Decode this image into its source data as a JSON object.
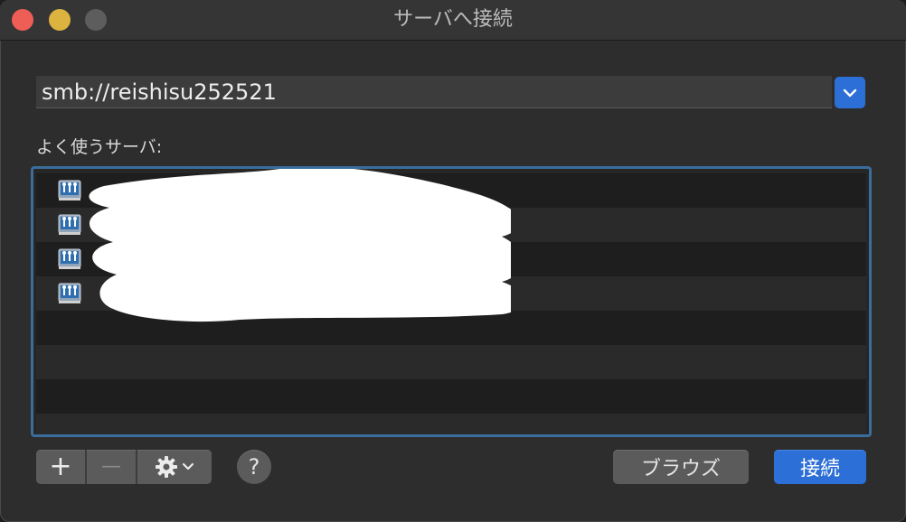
{
  "window": {
    "title": "サーバへ接続"
  },
  "server_address": {
    "value": "smb://reishisu252521"
  },
  "favorites": {
    "label": "よく使うサーバ:",
    "visible_entries": 4,
    "entries_redacted": true
  },
  "toolbar": {
    "add_label": "+",
    "remove_label": "—",
    "help_label": "?"
  },
  "buttons": {
    "browse_label": "ブラウズ",
    "connect_label": "接続"
  },
  "colors": {
    "accent": "#2c6fd6",
    "focus_ring": "#3b6d9c",
    "close": "#ee5e57",
    "minimize": "#ddb33f",
    "zoom_inactive": "#5d5d5d"
  },
  "icons": {
    "server": "network-server-icon",
    "dropdown": "chevron-down-icon",
    "actions": "gear-icon"
  }
}
